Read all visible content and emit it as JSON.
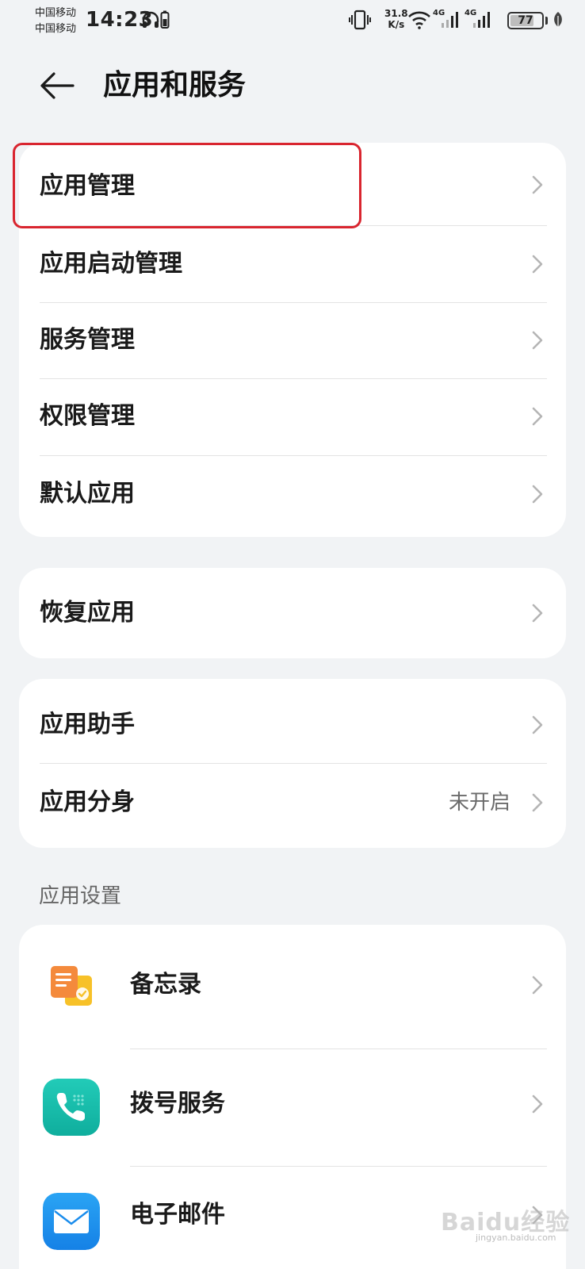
{
  "status_bar": {
    "carrier1": "中国移动",
    "carrier2": "中国移动",
    "time": "14:23",
    "speed_value": "31.8",
    "speed_unit": "K/s",
    "net1": "4G",
    "net2": "4G",
    "battery": "77",
    "battery_level": 0.77,
    "icons": [
      "headphones-icon",
      "phone-battery-icon",
      "vibrate-icon",
      "wifi-icon",
      "signal-icon",
      "battery-icon",
      "leaf-icon"
    ]
  },
  "header": {
    "back_icon": "back-arrow-icon",
    "title": "应用和服务"
  },
  "group1": {
    "items": [
      {
        "label": "应用管理"
      },
      {
        "label": "应用启动管理"
      },
      {
        "label": "服务管理"
      },
      {
        "label": "权限管理"
      },
      {
        "label": "默认应用"
      }
    ]
  },
  "group2": {
    "items": [
      {
        "label": "恢复应用"
      }
    ]
  },
  "group3": {
    "items": [
      {
        "label": "应用助手"
      },
      {
        "label": "应用分身",
        "value": "未开启"
      }
    ]
  },
  "app_settings": {
    "title": "应用设置",
    "items": [
      {
        "label": "备忘录",
        "icon": "memo-app-icon"
      },
      {
        "label": "拨号服务",
        "icon": "phone-app-icon"
      },
      {
        "label": "电子邮件",
        "icon": "email-app-icon"
      }
    ]
  },
  "watermark": {
    "text": "Baidu经验",
    "sub": "jingyan.baidu.com"
  },
  "colors": {
    "background": "#f1f3f5",
    "card": "#ffffff",
    "highlight": "#d9252f",
    "secondary_text": "#6b6b6b"
  }
}
